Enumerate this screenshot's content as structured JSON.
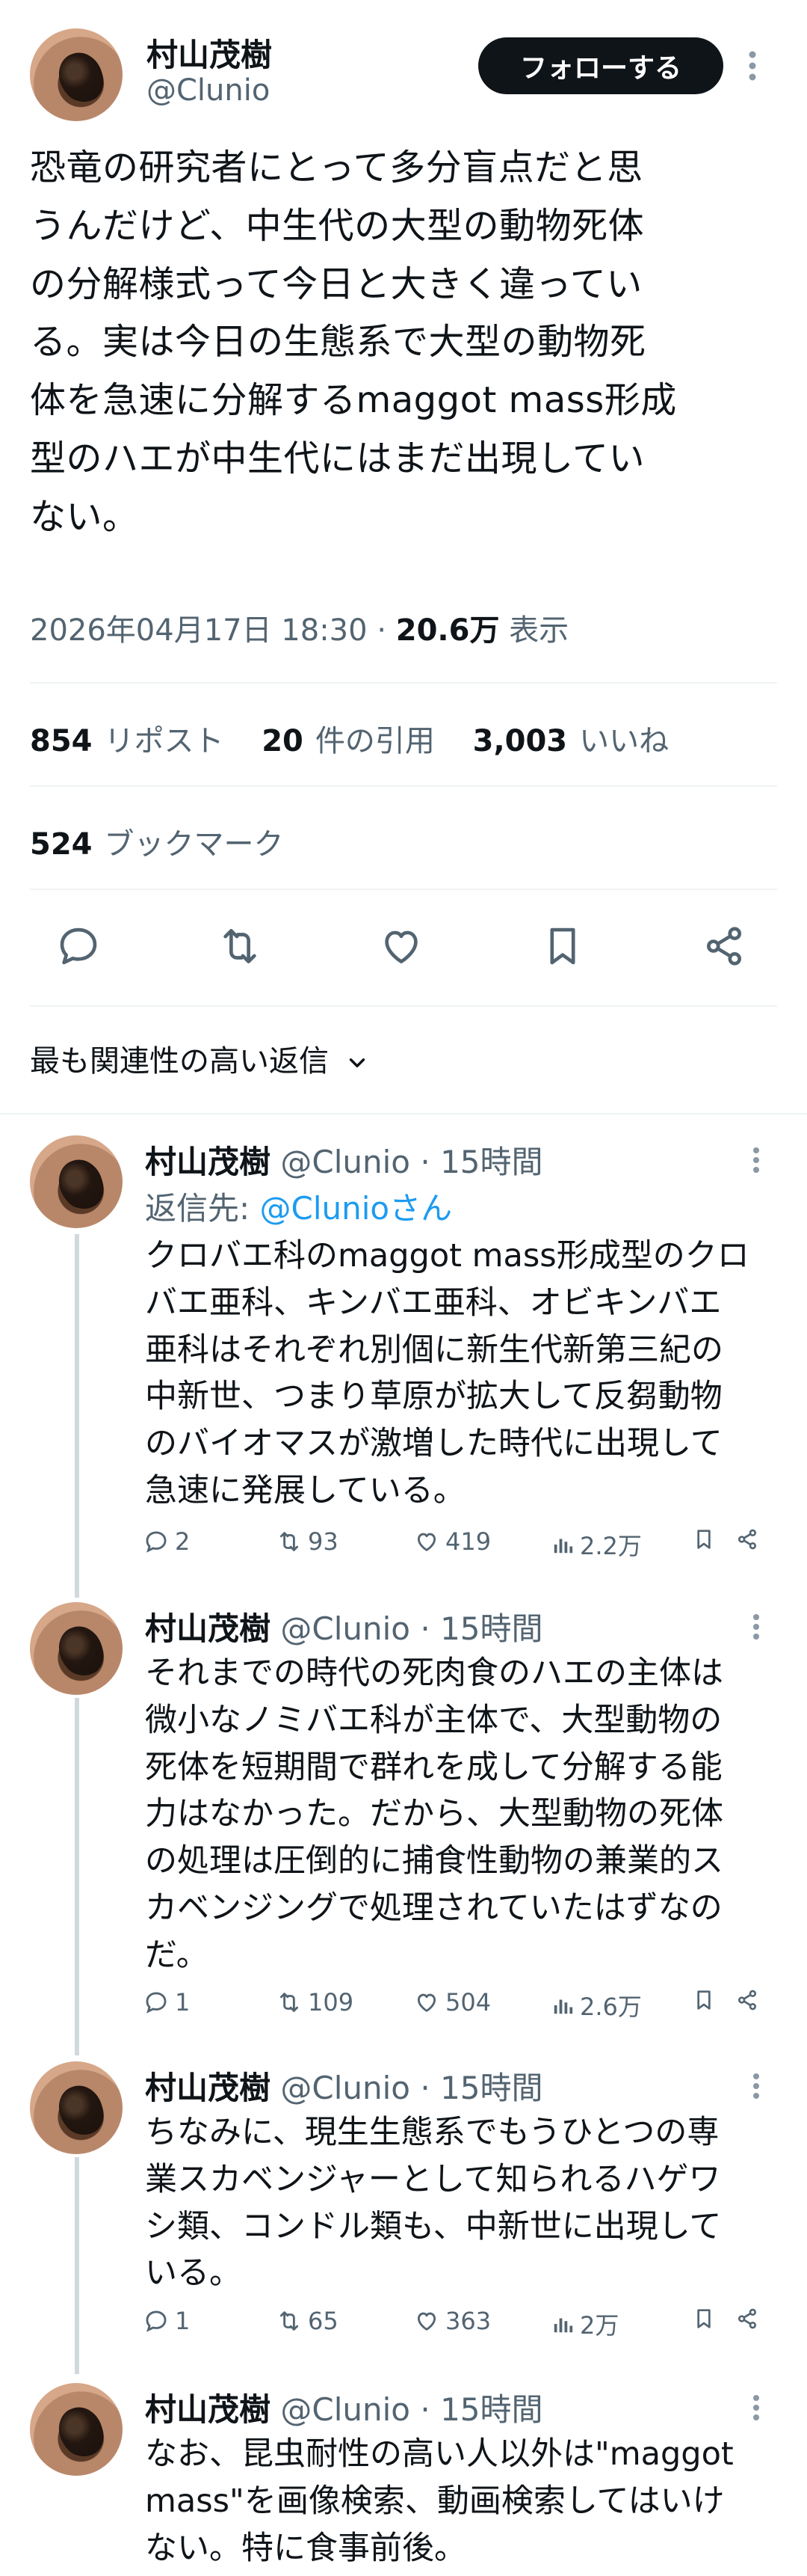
{
  "main": {
    "author": {
      "name": "村山茂樹",
      "handle": "@Clunio"
    },
    "follow_label": "フォローする",
    "text_lines": [
      "恐竜の研究者にとって多分盲点だと思",
      "うんだけど、中生代の大型の動物死体",
      "の分解様式って今日と大きく違ってい",
      "る。実は今日の生態系で大型の動物死",
      "体を急速に分解するmaggot mass形成",
      "型のハエが中生代にはまだ出現してい",
      "ない。"
    ],
    "timestamp": "2026年04月17日 18:30",
    "sep": "·",
    "views": "20.6万",
    "views_label": "表示",
    "stats": {
      "reposts": "854",
      "reposts_label": "リポスト",
      "quotes": "20",
      "quotes_label": "件の引用",
      "likes": "3,003",
      "likes_label": "いいね",
      "bookmarks": "524",
      "bookmarks_label": "ブックマーク"
    }
  },
  "sort": {
    "label": "最も関連性の高い返信"
  },
  "replies": [
    {
      "name": "村山茂樹",
      "handle": "@Clunio",
      "sep": "·",
      "time": "15時間",
      "reply_to_prefix": "返信先: ",
      "reply_to_handle": "@Clunioさん",
      "lines": [
        "クロバエ科のmaggot mass形成型のクロ",
        "バエ亜科、キンバエ亜科、オビキンバエ",
        "亜科はそれぞれ別個に新生代新第三紀の",
        "中新世、つまり草原が拡大して反芻動物",
        "のバイオマスが激増した時代に出現して",
        "急速に発展している。"
      ],
      "replies": "2",
      "reposts": "93",
      "likes": "419",
      "views": "2.2万"
    },
    {
      "name": "村山茂樹",
      "handle": "@Clunio",
      "sep": "·",
      "time": "15時間",
      "lines": [
        "それまでの時代の死肉食のハエの主体は",
        "微小なノミバエ科が主体で、大型動物の",
        "死体を短期間で群れを成して分解する能",
        "力はなかった。だから、大型動物の死体",
        "の処理は圧倒的に捕食性動物の兼業的ス",
        "カベンジングで処理されていたはずなの",
        "だ。"
      ],
      "replies": "1",
      "reposts": "109",
      "likes": "504",
      "views": "2.6万"
    },
    {
      "name": "村山茂樹",
      "handle": "@Clunio",
      "sep": "·",
      "time": "15時間",
      "lines": [
        "ちなみに、現生生態系でもうひとつの専",
        "業スカベンジャーとして知られるハゲワ",
        "シ類、コンドル類も、中新世に出現して",
        "いる。"
      ],
      "replies": "1",
      "reposts": "65",
      "likes": "363",
      "views": "2万"
    },
    {
      "name": "村山茂樹",
      "handle": "@Clunio",
      "sep": "·",
      "time": "15時間",
      "lines": [
        "なお、昆虫耐性の高い人以外は\"maggot",
        "mass\"を画像検索、動画検索してはいけ",
        "ない。特に食事前後。"
      ]
    }
  ]
}
